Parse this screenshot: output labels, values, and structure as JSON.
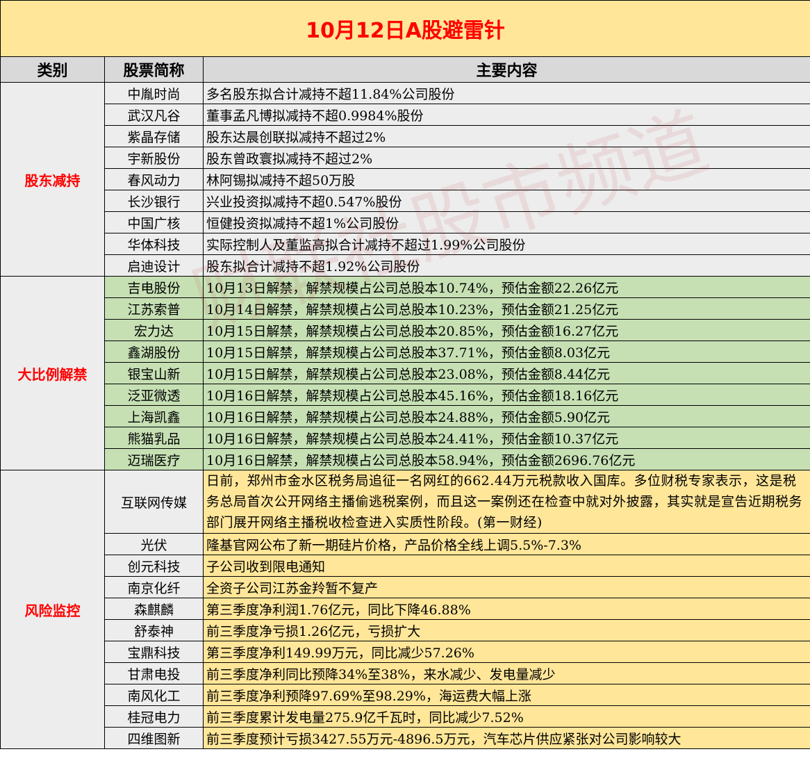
{
  "title": "10月12日A股避雷针",
  "headers": [
    "类别",
    "股票简称",
    "主要内容"
  ],
  "watermark": "财联社股市频道",
  "sections": [
    {
      "category": "股东减持",
      "rows": [
        [
          "中胤时尚",
          "多名股东拟合计减持不超11.84%公司股份"
        ],
        [
          "武汉凡谷",
          "董事孟凡博拟减持不超0.9984%股份"
        ],
        [
          "紫晶存储",
          "股东达晨创联拟减持不超过2%"
        ],
        [
          "宇新股份",
          "股东曾政寰拟减持不超过2%"
        ],
        [
          "春风动力",
          "林阿锡拟减持不超50万股"
        ],
        [
          "长沙银行",
          "兴业投资拟减持不超0.547%股份"
        ],
        [
          "中国广核",
          "恒健投资拟减持不超1%公司股份"
        ],
        [
          "华体科技",
          "实际控制人及董监高拟合计减持不超过1.99%公司股份"
        ],
        [
          "启迪设计",
          "股东拟合计减持不超1.92%公司股份"
        ]
      ]
    },
    {
      "category": "大比例解禁",
      "rows": [
        [
          "吉电股份",
          "10月13日解禁，解禁规模占公司总股本10.74%，预估金额22.26亿元"
        ],
        [
          "江苏索普",
          "10月14日解禁，解禁规模占公司总股本10.23%，预估金额21.25亿元"
        ],
        [
          "宏力达",
          "10月15日解禁，解禁规模占公司总股本20.85%，预估金额16.27亿元"
        ],
        [
          "鑫湖股份",
          "10月15日解禁，解禁规模占公司总股本37.71%，预估金额8.03亿元"
        ],
        [
          "银宝山新",
          "10月15日解禁，解禁规模占公司总股本23.08%，预估金额8.44亿元"
        ],
        [
          "泛亚微透",
          "10月16日解禁，解禁规模占公司总股本45.16%，预估金额18.16亿元"
        ],
        [
          "上海凯鑫",
          "10月16日解禁，解禁规模占公司总股本24.88%，预估金额5.90亿元"
        ],
        [
          "熊猫乳品",
          "10月16日解禁，解禁规模占公司总股本24.41%，预估金额10.37亿元"
        ],
        [
          "迈瑞医疗",
          "10月16日解禁，解禁规模占公司总股本58.94%，预估金额2696.76亿元"
        ]
      ]
    },
    {
      "category": "风险监控",
      "rows": [
        [
          "互联网传媒",
          "日前，郑州市金水区税务局追征一名网红的662.44万元税款收入国库。多位财税专家表示，这是税务总局首次公开网络主播偷逃税案例，而且这一案例还在检查中就对外披露，其实就是宣告近期税务部门展开网络主播税收检查进入实质性阶段。(第一财经)"
        ],
        [
          "光伏",
          "隆基官网公布了新一期硅片价格，产品价格全线上调5.5%-7.3%"
        ],
        [
          "创元科技",
          "子公司收到限电通知"
        ],
        [
          "南京化纤",
          "全资子公司江苏金羚暂不复产"
        ],
        [
          "森麒麟",
          "第三季度净利润1.76亿元，同比下降46.88%"
        ],
        [
          "舒泰神",
          "前三季度净亏损1.26亿元，亏损扩大"
        ],
        [
          "宝鼎科技",
          "第三季度净利149.99万元，同比减少57.26%"
        ],
        [
          "甘肃电投",
          "前三季度净利同比预降34%至38%，来水减少、发电量减少"
        ],
        [
          "南风化工",
          "前三季度净利预降97.69%至98.29%，海运费大幅上涨"
        ],
        [
          "桂冠电力",
          "前三季度累计发电量275.9亿千瓦时，同比减少7.52%"
        ],
        [
          "四维图新",
          "前三季度预计亏损3427.55万元-4896.5万元，汽车芯片供应紧张对公司影响较大"
        ]
      ]
    }
  ]
}
